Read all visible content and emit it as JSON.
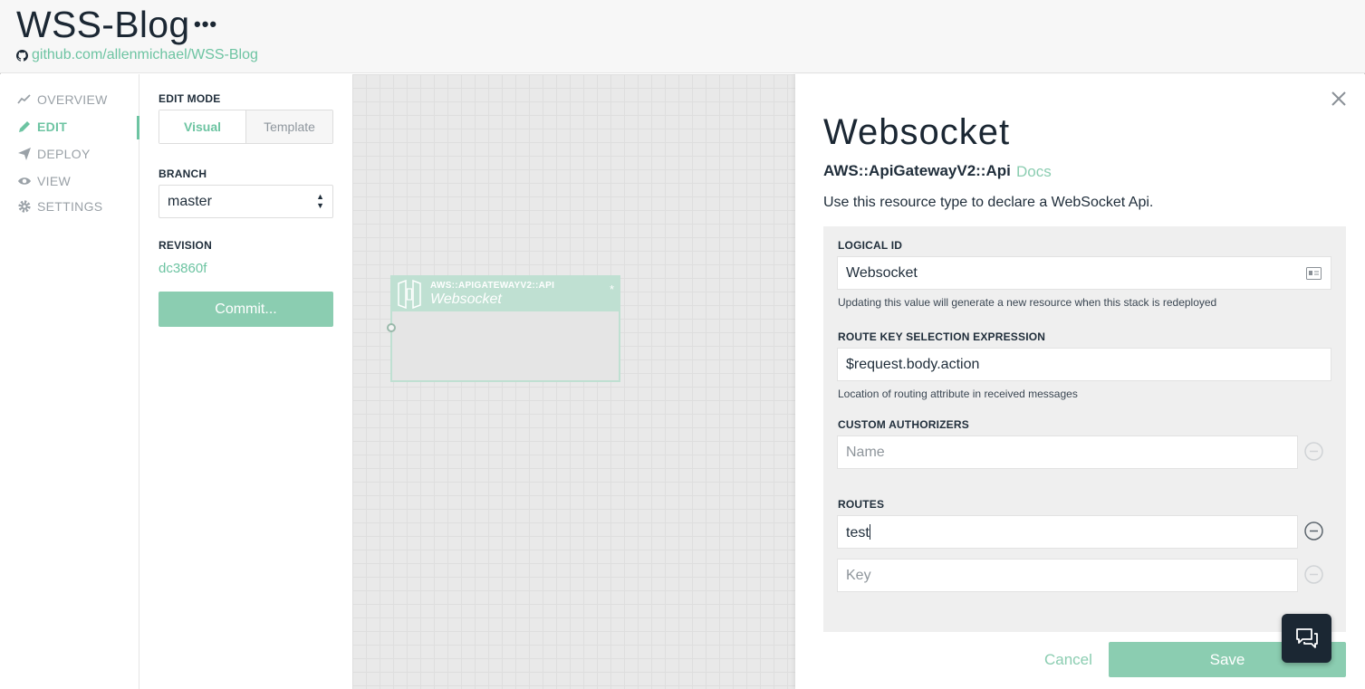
{
  "header": {
    "title": "WSS-Blog",
    "more": "•••",
    "repo": "github.com/allenmichael/WSS-Blog"
  },
  "nav": {
    "items": [
      {
        "label": "OVERVIEW",
        "icon": "chart-line-icon"
      },
      {
        "label": "EDIT",
        "icon": "pencil-icon",
        "active": true
      },
      {
        "label": "DEPLOY",
        "icon": "paper-plane-icon"
      },
      {
        "label": "VIEW",
        "icon": "eye-icon"
      },
      {
        "label": "SETTINGS",
        "icon": "gear-icon"
      }
    ]
  },
  "edit": {
    "mode_label": "EDIT MODE",
    "mode_options": [
      "Visual",
      "Template"
    ],
    "mode_selected": "Visual",
    "branch_label": "BRANCH",
    "branch_value": "master",
    "revision_label": "REVISION",
    "revision_value": "dc3860f",
    "commit_label": "Commit..."
  },
  "canvas": {
    "node": {
      "type": "AWS::APIGATEWAYV2::API",
      "name": "Websocket",
      "marker": "*"
    }
  },
  "drawer": {
    "title": "Websocket",
    "type": "AWS::ApiGatewayV2::Api",
    "docs_link": "Docs",
    "description": "Use this resource type to declare a WebSocket Api.",
    "logical_id_label": "LOGICAL ID",
    "logical_id_value": "Websocket",
    "logical_id_hint": "Updating this value will generate a new resource when this stack is redeployed",
    "route_key_label": "ROUTE KEY SELECTION EXPRESSION",
    "route_key_value": "$request.body.action",
    "route_key_hint": "Location of routing attribute in received messages",
    "authorizers_label": "CUSTOM AUTHORIZERS",
    "authorizers_placeholder": "Name",
    "routes_label": "ROUTES",
    "routes_value": "test",
    "routes_placeholder": "Key",
    "cancel_label": "Cancel",
    "save_label": "Save"
  },
  "colors": {
    "accent": "#6dc4a2",
    "accent_button": "#8bcdb1",
    "dark": "#1b2733"
  }
}
